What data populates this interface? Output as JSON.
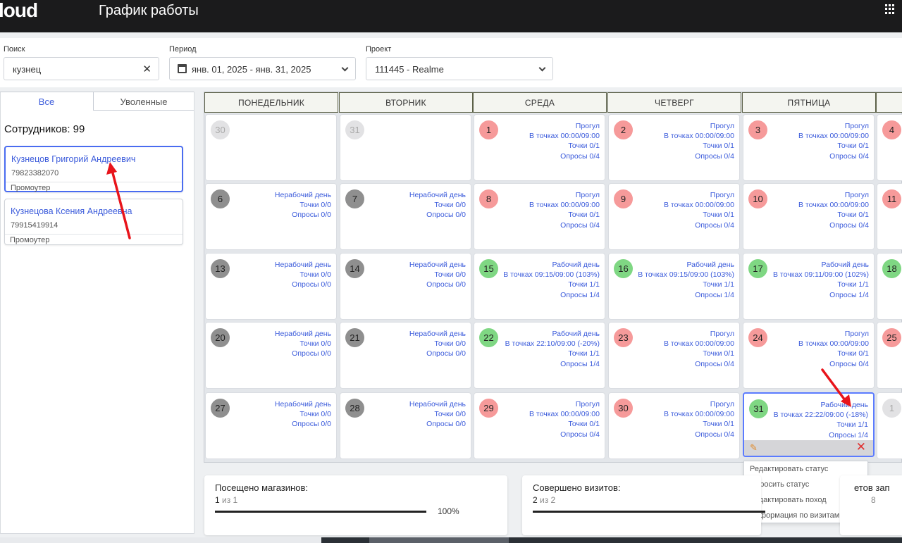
{
  "header": {
    "logo": "loud",
    "title": "График работы"
  },
  "filters": {
    "search_label": "Поиск",
    "search_value": "кузнец",
    "period_label": "Период",
    "period_value": "янв. 01, 2025 - янв. 31, 2025",
    "project_label": "Проект",
    "project_value": "111445 - Realme"
  },
  "left": {
    "tabs": [
      "Все",
      "Уволенные"
    ],
    "employees_count": "Сотрудников: 99",
    "employees": [
      {
        "name": "Кузнецов Григорий Андреевич",
        "phone": "79823382070",
        "role": "Промоутер"
      },
      {
        "name": "Кузнецова Ксения Андреевна",
        "phone": "79915419914",
        "role": "Промоутер"
      }
    ]
  },
  "calendar": {
    "days": [
      "ПОНЕДЕЛЬНИК",
      "ВТОРНИК",
      "СРЕДА",
      "ЧЕТВЕРГ",
      "ПЯТНИЦА"
    ],
    "weeks": [
      [
        {
          "n": "30",
          "c": "light",
          "lines": []
        },
        {
          "n": "31",
          "c": "light",
          "lines": []
        },
        {
          "n": "1",
          "c": "red",
          "lines": [
            "Прогул",
            "В точках 00:00/09:00",
            "Точки 0/1",
            "Опросы 0/4"
          ]
        },
        {
          "n": "2",
          "c": "red",
          "lines": [
            "Прогул",
            "В точках 00:00/09:00",
            "Точки 0/1",
            "Опросы 0/4"
          ]
        },
        {
          "n": "3",
          "c": "red",
          "lines": [
            "Прогул",
            "В точках 00:00/09:00",
            "Точки 0/1",
            "Опросы 0/4"
          ]
        },
        {
          "n": "4",
          "c": "red",
          "lines": []
        }
      ],
      [
        {
          "n": "6",
          "c": "gray",
          "lines": [
            "Нерабочий день",
            "Точки 0/0",
            "Опросы 0/0"
          ]
        },
        {
          "n": "7",
          "c": "gray",
          "lines": [
            "Нерабочий день",
            "Точки 0/0",
            "Опросы 0/0"
          ]
        },
        {
          "n": "8",
          "c": "red",
          "lines": [
            "Прогул",
            "В точках 00:00/09:00",
            "Точки 0/1",
            "Опросы 0/4"
          ]
        },
        {
          "n": "9",
          "c": "red",
          "lines": [
            "Прогул",
            "В точках 00:00/09:00",
            "Точки 0/1",
            "Опросы 0/4"
          ]
        },
        {
          "n": "10",
          "c": "red",
          "lines": [
            "Прогул",
            "В точках 00:00/09:00",
            "Точки 0/1",
            "Опросы 0/4"
          ]
        },
        {
          "n": "11",
          "c": "red",
          "lines": []
        }
      ],
      [
        {
          "n": "13",
          "c": "gray",
          "lines": [
            "Нерабочий день",
            "Точки 0/0",
            "Опросы 0/0"
          ]
        },
        {
          "n": "14",
          "c": "gray",
          "lines": [
            "Нерабочий день",
            "Точки 0/0",
            "Опросы 0/0"
          ]
        },
        {
          "n": "15",
          "c": "green",
          "lines": [
            "Рабочий день",
            "В точках 09:15/09:00 (103%)",
            "Точки 1/1",
            "Опросы 1/4"
          ]
        },
        {
          "n": "16",
          "c": "green",
          "lines": [
            "Рабочий день",
            "В точках 09:15/09:00 (103%)",
            "Точки 1/1",
            "Опросы 1/4"
          ]
        },
        {
          "n": "17",
          "c": "green",
          "lines": [
            "Рабочий день",
            "В точках 09:11/09:00 (102%)",
            "Точки 1/1",
            "Опросы 1/4"
          ]
        },
        {
          "n": "18",
          "c": "green",
          "lines": []
        }
      ],
      [
        {
          "n": "20",
          "c": "gray",
          "lines": [
            "Нерабочий день",
            "Точки 0/0",
            "Опросы 0/0"
          ]
        },
        {
          "n": "21",
          "c": "gray",
          "lines": [
            "Нерабочий день",
            "Точки 0/0",
            "Опросы 0/0"
          ]
        },
        {
          "n": "22",
          "c": "green",
          "lines": [
            "Рабочий день",
            "В точках 22:10/09:00 (-20%)",
            "Точки 1/1",
            "Опросы 1/4"
          ]
        },
        {
          "n": "23",
          "c": "red",
          "lines": [
            "Прогул",
            "В точках 00:00/09:00",
            "Точки 0/1",
            "Опросы 0/4"
          ]
        },
        {
          "n": "24",
          "c": "red",
          "lines": [
            "Прогул",
            "В точках 00:00/09:00",
            "Точки 0/1",
            "Опросы 0/4"
          ]
        },
        {
          "n": "25",
          "c": "red",
          "lines": []
        }
      ],
      [
        {
          "n": "27",
          "c": "gray",
          "lines": [
            "Нерабочий день",
            "Точки 0/0",
            "Опросы 0/0"
          ]
        },
        {
          "n": "28",
          "c": "gray",
          "lines": [
            "Нерабочий день",
            "Точки 0/0",
            "Опросы 0/0"
          ]
        },
        {
          "n": "29",
          "c": "red",
          "lines": [
            "Прогул",
            "В точках 00:00/09:00",
            "Точки 0/1",
            "Опросы 0/4"
          ]
        },
        {
          "n": "30",
          "c": "red",
          "lines": [
            "Прогул",
            "В точках 00:00/09:00",
            "Точки 0/1",
            "Опросы 0/4"
          ]
        },
        {
          "n": "31",
          "c": "green",
          "lines": [
            "Рабочий день",
            "В точках 22:22/09:00 (-18%)",
            "Точки 1/1",
            "Опросы 1/4"
          ],
          "selected": true
        },
        {
          "n": "1",
          "c": "light",
          "lines": []
        }
      ]
    ]
  },
  "context_menu": [
    "Редактировать статус",
    "Сбросить статус",
    "Редактировать поход",
    "Информация по визитам"
  ],
  "stats": [
    {
      "title": "Посещено магазинов:",
      "value_main": "1",
      "value_rest": " из 1",
      "percent_text": "100%",
      "progress": 1.0
    },
    {
      "title": "Совершено визитов:",
      "value_main": "2",
      "value_rest": " из 2",
      "percent_text": "",
      "progress": 1.0
    },
    {
      "title": "етов зап",
      "value_main": "",
      "value_rest": "8",
      "percent_text": "",
      "progress": 0
    }
  ]
}
